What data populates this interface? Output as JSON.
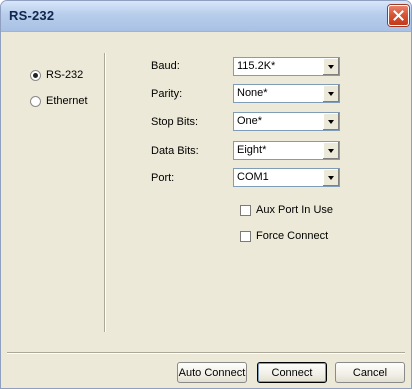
{
  "window": {
    "title": "RS-232",
    "close_icon": "close-icon",
    "titlebar_color": "#b8cdeb",
    "close_color": "#d55233"
  },
  "connection_type": {
    "options": [
      {
        "label": "RS-232",
        "selected": true
      },
      {
        "label": "Ethernet",
        "selected": false
      }
    ]
  },
  "fields": {
    "baud": {
      "label": "Baud:",
      "value": "115.2K*"
    },
    "parity": {
      "label": "Parity:",
      "value": "None*"
    },
    "stop_bits": {
      "label": "Stop Bits:",
      "value": "One*"
    },
    "data_bits": {
      "label": "Data Bits:",
      "value": "Eight*"
    },
    "port": {
      "label": "Port:",
      "value": "COM1"
    }
  },
  "checkboxes": {
    "aux_port": {
      "label": "Aux Port In Use",
      "checked": false
    },
    "force_connect": {
      "label": "Force Connect",
      "checked": false
    }
  },
  "buttons": {
    "auto_connect": "Auto Connect",
    "connect": "Connect",
    "cancel": "Cancel"
  }
}
